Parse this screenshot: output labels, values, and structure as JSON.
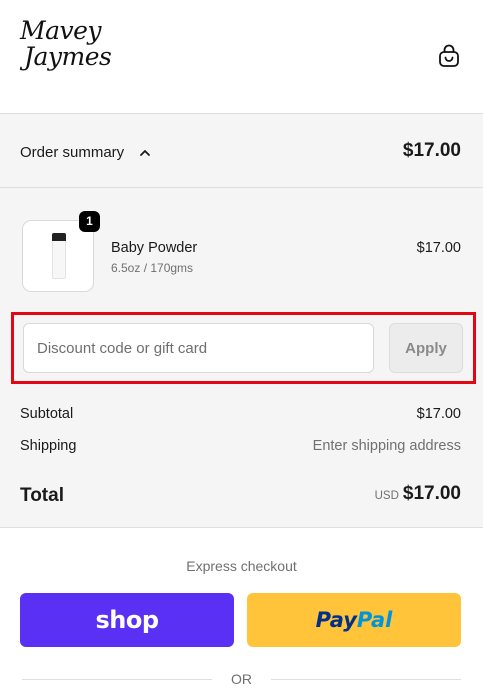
{
  "header": {
    "logo_line1": "Mavey",
    "logo_line2": "Jaymes",
    "cart_icon": "shopping-bag-icon"
  },
  "summary": {
    "toggle_label": "Order summary",
    "toggle_icon": "chevron-up-icon",
    "total": "$17.00"
  },
  "product": {
    "name": "Baby Powder",
    "variant": "6.5oz / 170gms",
    "price": "$17.00",
    "quantity": "1"
  },
  "discount": {
    "placeholder": "Discount code or gift card",
    "value": "",
    "apply_label": "Apply"
  },
  "totals": {
    "subtotal_label": "Subtotal",
    "subtotal_value": "$17.00",
    "shipping_label": "Shipping",
    "shipping_value": "Enter shipping address",
    "total_label": "Total",
    "currency": "USD",
    "total_value": "$17.00"
  },
  "express": {
    "label": "Express checkout",
    "shop_label": "shop",
    "paypal_part1": "Pay",
    "paypal_part2": "Pal",
    "or_label": "OR"
  },
  "colors": {
    "shop_purple": "#5a31f4",
    "paypal_yellow": "#ffc43a",
    "highlight_red": "#e30613"
  }
}
